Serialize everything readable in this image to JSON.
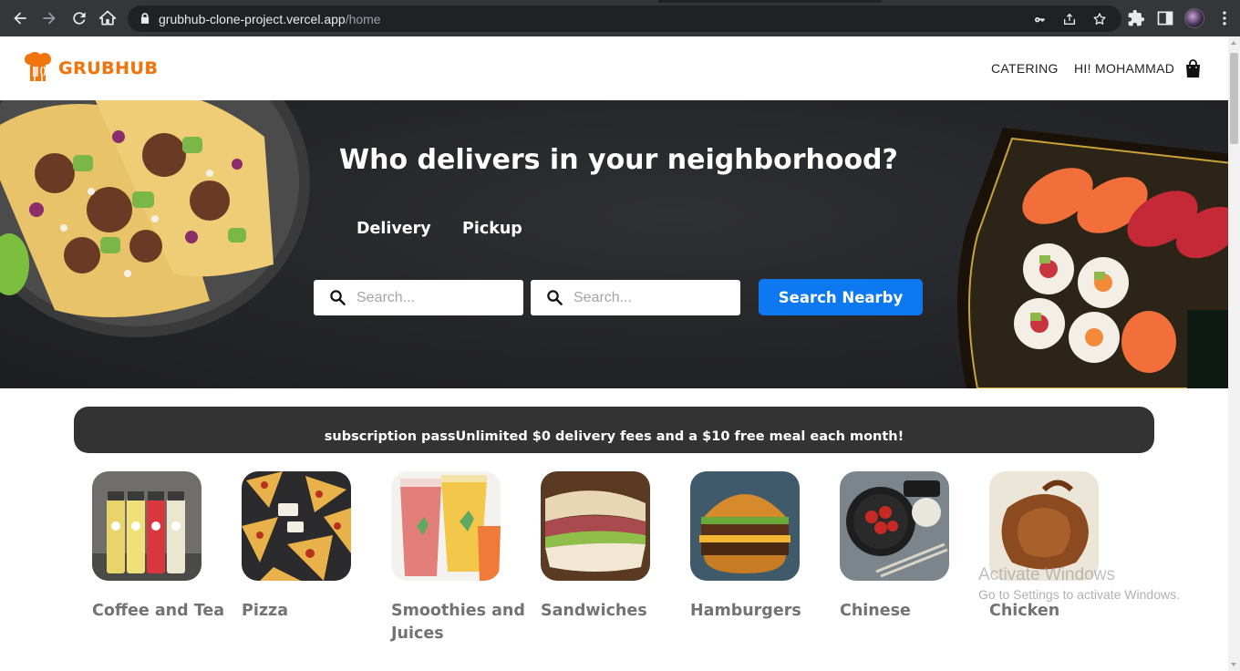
{
  "browser": {
    "url_host": "grubhub-clone-project.vercel.app",
    "url_path": "/home"
  },
  "header": {
    "logo_text": "GRUBHUB",
    "catering_label": "CATERING",
    "greeting_label": "HI! MOHAMMAD"
  },
  "hero": {
    "title": "Who delivers in your neighborhood?",
    "tabs": [
      "Delivery",
      "Pickup"
    ],
    "search_placeholder_1": "Search...",
    "search_placeholder_2": "Search...",
    "search_button_label": "Search Nearby"
  },
  "promo": {
    "text": "subscription passUnlimited $0 delivery fees and a $10 free meal each month!"
  },
  "categories": [
    {
      "label": "Coffee and Tea",
      "icon": "juice-bottles-image"
    },
    {
      "label": "Pizza",
      "icon": "pizza-slices-image"
    },
    {
      "label": "Smoothies and Juices",
      "icon": "smoothie-cups-image"
    },
    {
      "label": "Sandwiches",
      "icon": "sandwich-image"
    },
    {
      "label": "Hamburgers",
      "icon": "hamburger-image"
    },
    {
      "label": "Chinese",
      "icon": "chinese-food-image"
    },
    {
      "label": "Chicken",
      "icon": "roast-chicken-image"
    }
  ],
  "watermark": {
    "line1": "Activate Windows",
    "line2": "Go to Settings to activate Windows."
  },
  "colors": {
    "brand_orange": "#f2740d",
    "search_button_blue": "#0d78f0",
    "promo_background": "#333333",
    "category_text": "#737373"
  }
}
